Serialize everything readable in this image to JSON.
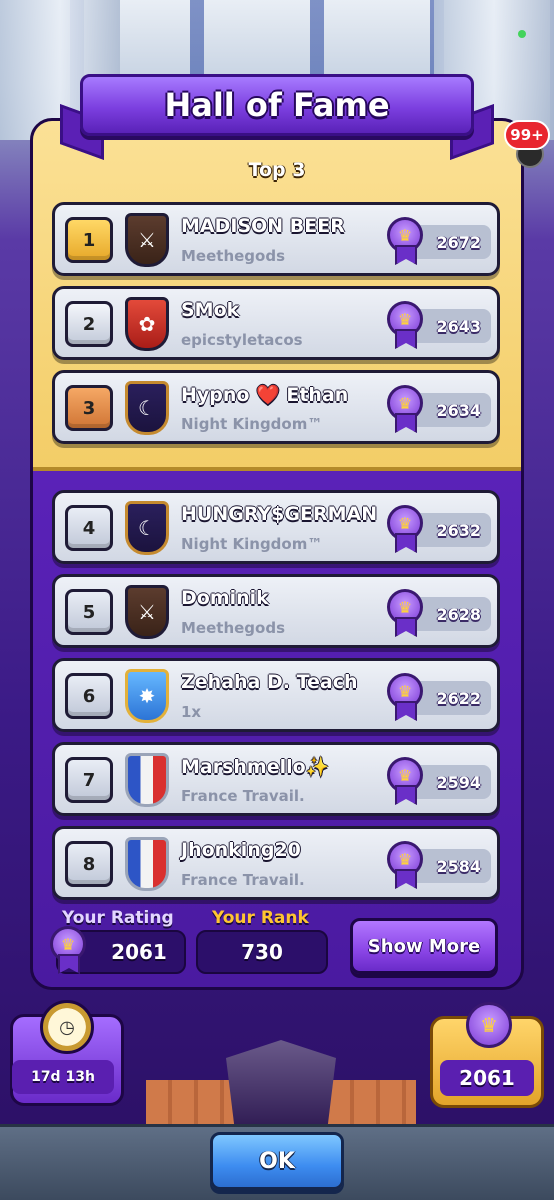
{
  "header": {
    "title": "Hall of Fame"
  },
  "notification": {
    "count": "99+"
  },
  "top_section": {
    "label": "Top 3"
  },
  "players": [
    {
      "rank": "1",
      "name": "MADISON BEER",
      "clan": "Meethegods",
      "trophies": "2672",
      "badge_icon": "bamboo-icon",
      "badge_style": "dark",
      "rank_style": "gold"
    },
    {
      "rank": "2",
      "name": "SMok",
      "clan": "epicstyletacos",
      "trophies": "2643",
      "badge_icon": "fan-icon",
      "badge_style": "red",
      "rank_style": "silver"
    },
    {
      "rank": "3",
      "name": "Hypno ❤️ Ethan",
      "clan": "Night Kingdom™",
      "trophies": "2634",
      "badge_icon": "moon-icon",
      "badge_style": "night",
      "rank_style": "bronze"
    },
    {
      "rank": "4",
      "name": "HUNGRY$GERMAN",
      "clan": "Night Kingdom™",
      "trophies": "2632",
      "badge_icon": "moon-icon",
      "badge_style": "night",
      "rank_style": "plain"
    },
    {
      "rank": "5",
      "name": "Dominik",
      "clan": "Meethegods",
      "trophies": "2628",
      "badge_icon": "bamboo-icon",
      "badge_style": "dark",
      "rank_style": "plain"
    },
    {
      "rank": "6",
      "name": "Zehaha D. Teach",
      "clan": "1x",
      "trophies": "2622",
      "badge_icon": "star-icon",
      "badge_style": "blue",
      "rank_style": "plain"
    },
    {
      "rank": "7",
      "name": "Marshmello✨",
      "clan": "France Travail.",
      "trophies": "2594",
      "badge_icon": "flag-icon",
      "badge_style": "fr",
      "rank_style": "plain"
    },
    {
      "rank": "8",
      "name": "Jhonking20",
      "clan": "France Travail.",
      "trophies": "2584",
      "badge_icon": "flag-icon",
      "badge_style": "fr",
      "rank_style": "plain"
    }
  ],
  "footer": {
    "your_rating_label": "Your Rating",
    "your_rating_value": "2061",
    "your_rank_label": "Your Rank",
    "your_rank_value": "730",
    "show_more_label": "Show More"
  },
  "season": {
    "time_left": "17d 13h",
    "trophies": "2061"
  },
  "ok_label": "OK",
  "colors": {
    "gold_accent": "#f3cd67",
    "purple_panel": "#5a22b8",
    "ok_button": "#3d8cf0"
  }
}
